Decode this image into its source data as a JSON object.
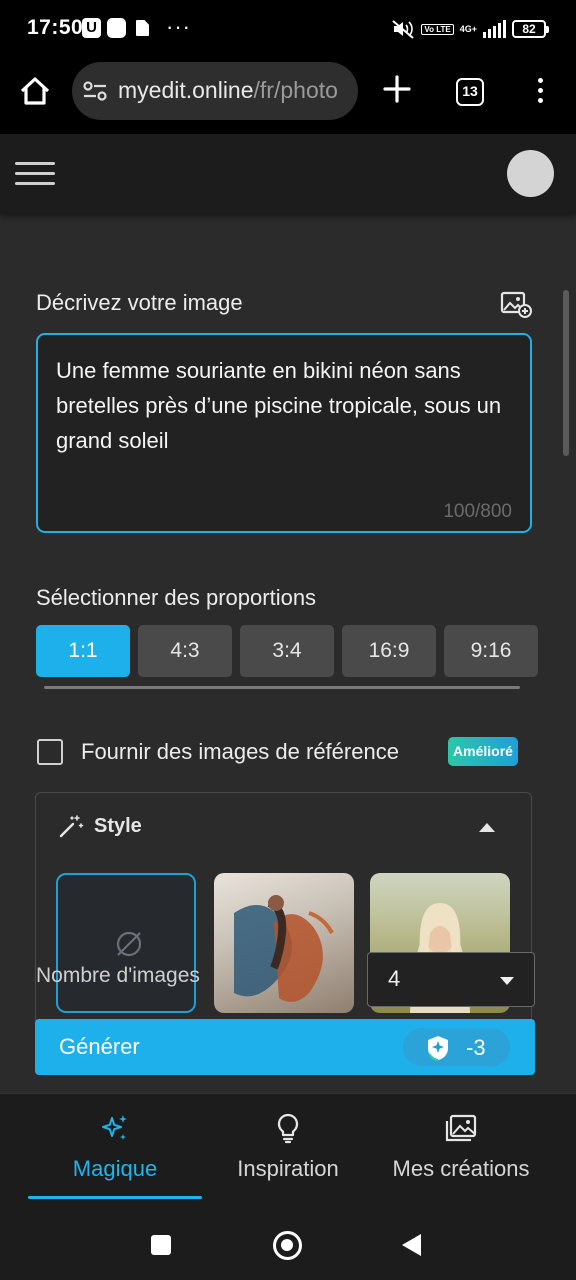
{
  "status_bar": {
    "time": "17:50",
    "u_icon": "U",
    "more_dots": "···",
    "network": "4G+",
    "lte": "Vo LTE",
    "battery": "82"
  },
  "browser": {
    "url_host": "myedit.online",
    "url_path": "/fr/photo",
    "tab_count": "13"
  },
  "editor": {
    "prompt_heading": "Décrivez votre image",
    "prompt_text": "Une femme souriante en bikini néon sans bretelles près d’une piscine tropicale, sous un grand soleil",
    "prompt_counter": "100/800",
    "ratio_heading": "Sélectionner des proportions",
    "ratios": [
      {
        "label": "1:1",
        "selected": true
      },
      {
        "label": "4:3",
        "selected": false
      },
      {
        "label": "3:4",
        "selected": false
      },
      {
        "label": "16:9",
        "selected": false
      },
      {
        "label": "9:16",
        "selected": false
      }
    ],
    "reference_label": "Fournir des images de référence",
    "reference_checked": false,
    "reference_badge": "Amélioré",
    "style_title": "Style",
    "count_label": "Nombre d'images",
    "count_value": "4",
    "generate_label": "Générer",
    "generate_cost": "-3"
  },
  "bottom_nav": [
    {
      "label": "Magique",
      "icon": "sparkles-icon",
      "active": true
    },
    {
      "label": "Inspiration",
      "icon": "lightbulb-icon",
      "active": false
    },
    {
      "label": "Mes créations",
      "icon": "images-icon",
      "active": false
    }
  ],
  "colors": {
    "accent": "#1eb0ea",
    "background": "#2b2b2b",
    "header": "#1c1c1c",
    "badge_start": "#2dc6a8",
    "badge_end": "#1e9fd8"
  }
}
